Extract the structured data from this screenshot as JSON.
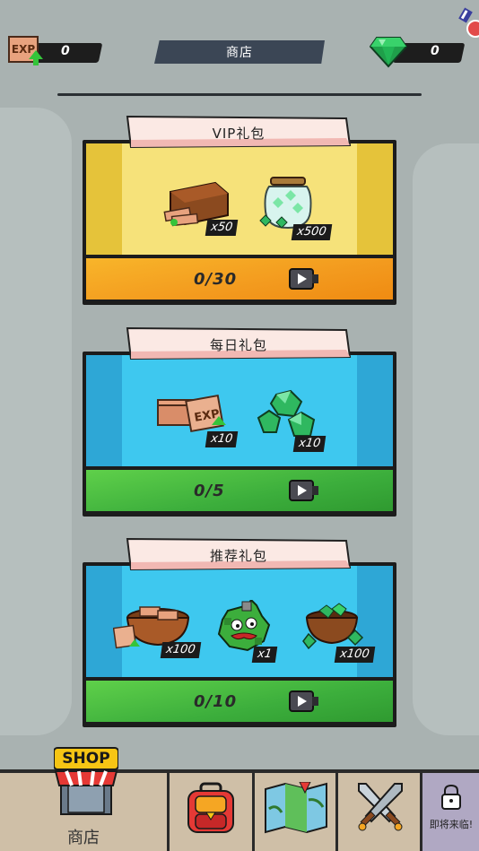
{
  "header": {
    "exp_icon_label": "EXP",
    "exp_value": "0",
    "title": "商店",
    "gem_value": "0"
  },
  "panels": [
    {
      "title": "VIP礼包",
      "progress": "0/30",
      "theme": {
        "side": "#e5c33a",
        "mid": "#f6e27a",
        "bar": "#f39a1e",
        "bar_light": "#f8b52a"
      },
      "items": [
        {
          "icon": "exp-cards-crate-icon",
          "qty": "x50"
        },
        {
          "icon": "gem-jar-icon",
          "qty": "x500"
        }
      ]
    },
    {
      "title": "每日礼包",
      "progress": "0/5",
      "theme": {
        "side": "#2ea7d6",
        "mid": "#3ec8ef",
        "bar": "#3cae3c",
        "bar_light": "#5fd04a"
      },
      "items": [
        {
          "icon": "exp-cards-icon",
          "qty": "x10"
        },
        {
          "icon": "gem-cluster-icon",
          "qty": "x10"
        }
      ]
    },
    {
      "title": "推荐礼包",
      "progress": "0/10",
      "theme": {
        "side": "#2ea7d6",
        "mid": "#3ec8ef",
        "bar": "#3cae3c",
        "bar_light": "#5fd04a"
      },
      "items": [
        {
          "icon": "exp-cards-bowl-icon",
          "qty": "x100"
        },
        {
          "icon": "green-puzzle-character-icon",
          "qty": "x1"
        },
        {
          "icon": "gem-bowl-icon",
          "qty": "x100"
        }
      ]
    }
  ],
  "nav": {
    "shop_sign": "SHOP",
    "shop_label": "商店",
    "tabs": [
      {
        "icon": "backpack-icon"
      },
      {
        "icon": "map-icon"
      },
      {
        "icon": "crossed-swords-icon"
      },
      {
        "icon": "lock-icon"
      }
    ],
    "soon_label": "即将来临!"
  }
}
